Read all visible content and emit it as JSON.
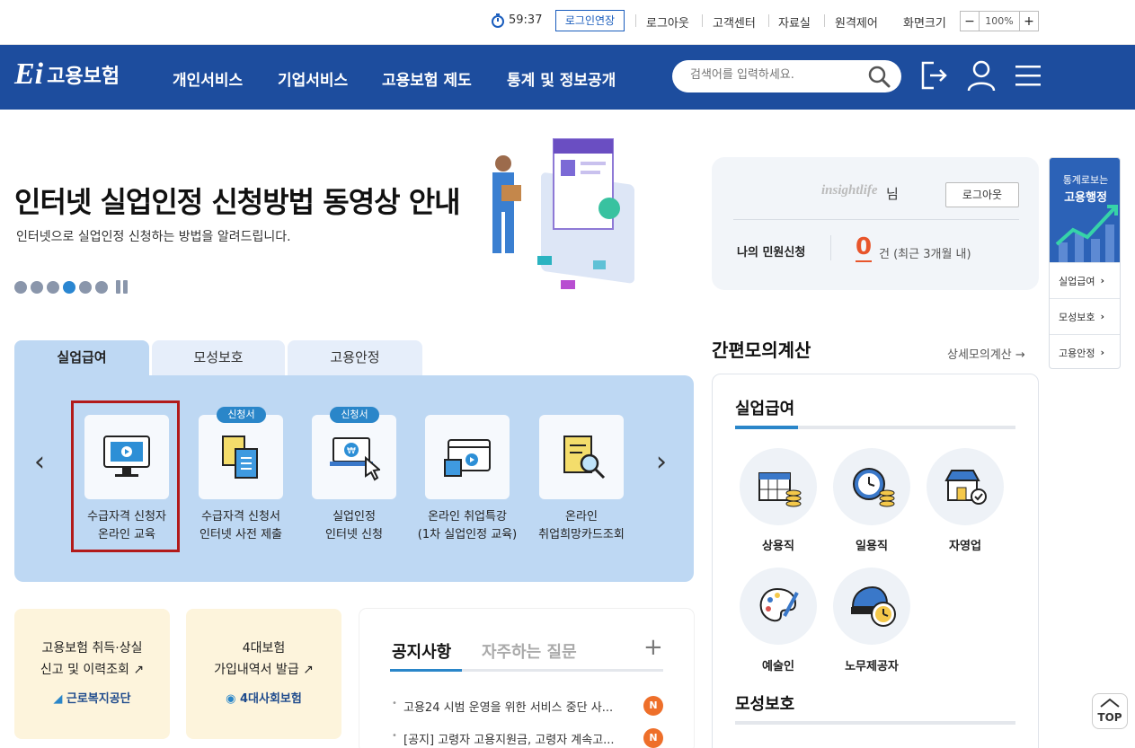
{
  "util": {
    "timer": "59:37",
    "extend_login": "로그인연장",
    "logout": "로그아웃",
    "customer_center": "고객센터",
    "library": "자료실",
    "remote": "원격제어",
    "screen_size": "화면크기",
    "zoom_minus": "−",
    "zoom_value": "100%",
    "zoom_plus": "+"
  },
  "nav": {
    "logo_mark": "Ei",
    "logo_text": "고용보험",
    "menu": [
      "개인서비스",
      "기업서비스",
      "고용보험 제도",
      "통계 및 정보공개"
    ],
    "search_placeholder": "검색어를 입력하세요."
  },
  "hero": {
    "title": "인터넷 실업인정 신청방법 동영상 안내",
    "subtitle": "인터넷으로 실업인정 신청하는 방법을 알려드립니다.",
    "slide_count": 6,
    "active_slide": 4
  },
  "user": {
    "logo_text": "insightlife",
    "suffix": "님",
    "logout": "로그아웃",
    "my_apps_label": "나의 민원신청",
    "count": "0",
    "count_unit": "건 (최근 3개월 내)"
  },
  "side_widget": {
    "line1": "통계로보는",
    "line2": "고용행정",
    "links": [
      "실업급여",
      "모성보호",
      "고용안정"
    ]
  },
  "tabs": [
    "실업급여",
    "모성보호",
    "고용안정"
  ],
  "services": [
    {
      "label1": "수급자격 신청자",
      "label2": "온라인 교육",
      "badge": ""
    },
    {
      "label1": "수급자격 신청서",
      "label2": "인터넷 사전 제출",
      "badge": "신청서"
    },
    {
      "label1": "실업인정",
      "label2": "인터넷 신청",
      "badge": "신청서"
    },
    {
      "label1": "온라인 취업특강",
      "label2": "(1차 실업인정 교육)",
      "badge": ""
    },
    {
      "label1": "온라인",
      "label2": "취업희망카드조회",
      "badge": ""
    }
  ],
  "cards": [
    {
      "line1": "고용보험 취득·상실",
      "line2": "신고 및 이력조회",
      "org": "근로복지공단"
    },
    {
      "line1": "4대보험",
      "line2": "가입내역서 발급",
      "org": "4대사회보험"
    }
  ],
  "notice": {
    "tab1": "공지사항",
    "tab2": "자주하는 질문",
    "plus": "+",
    "items": [
      "고용24 시범 운영을 위한 서비스 중단 사...",
      "[공지] 고령자 고용지원금, 고령자 계속고..."
    ],
    "badge": "N"
  },
  "calc": {
    "title": "간편모의계산",
    "more": "상세모의계산 →",
    "section1": "실업급여",
    "section2": "모성보호",
    "items": [
      "상용직",
      "일용직",
      "자영업",
      "예술인",
      "노무제공자"
    ]
  },
  "top_button": "TOP"
}
